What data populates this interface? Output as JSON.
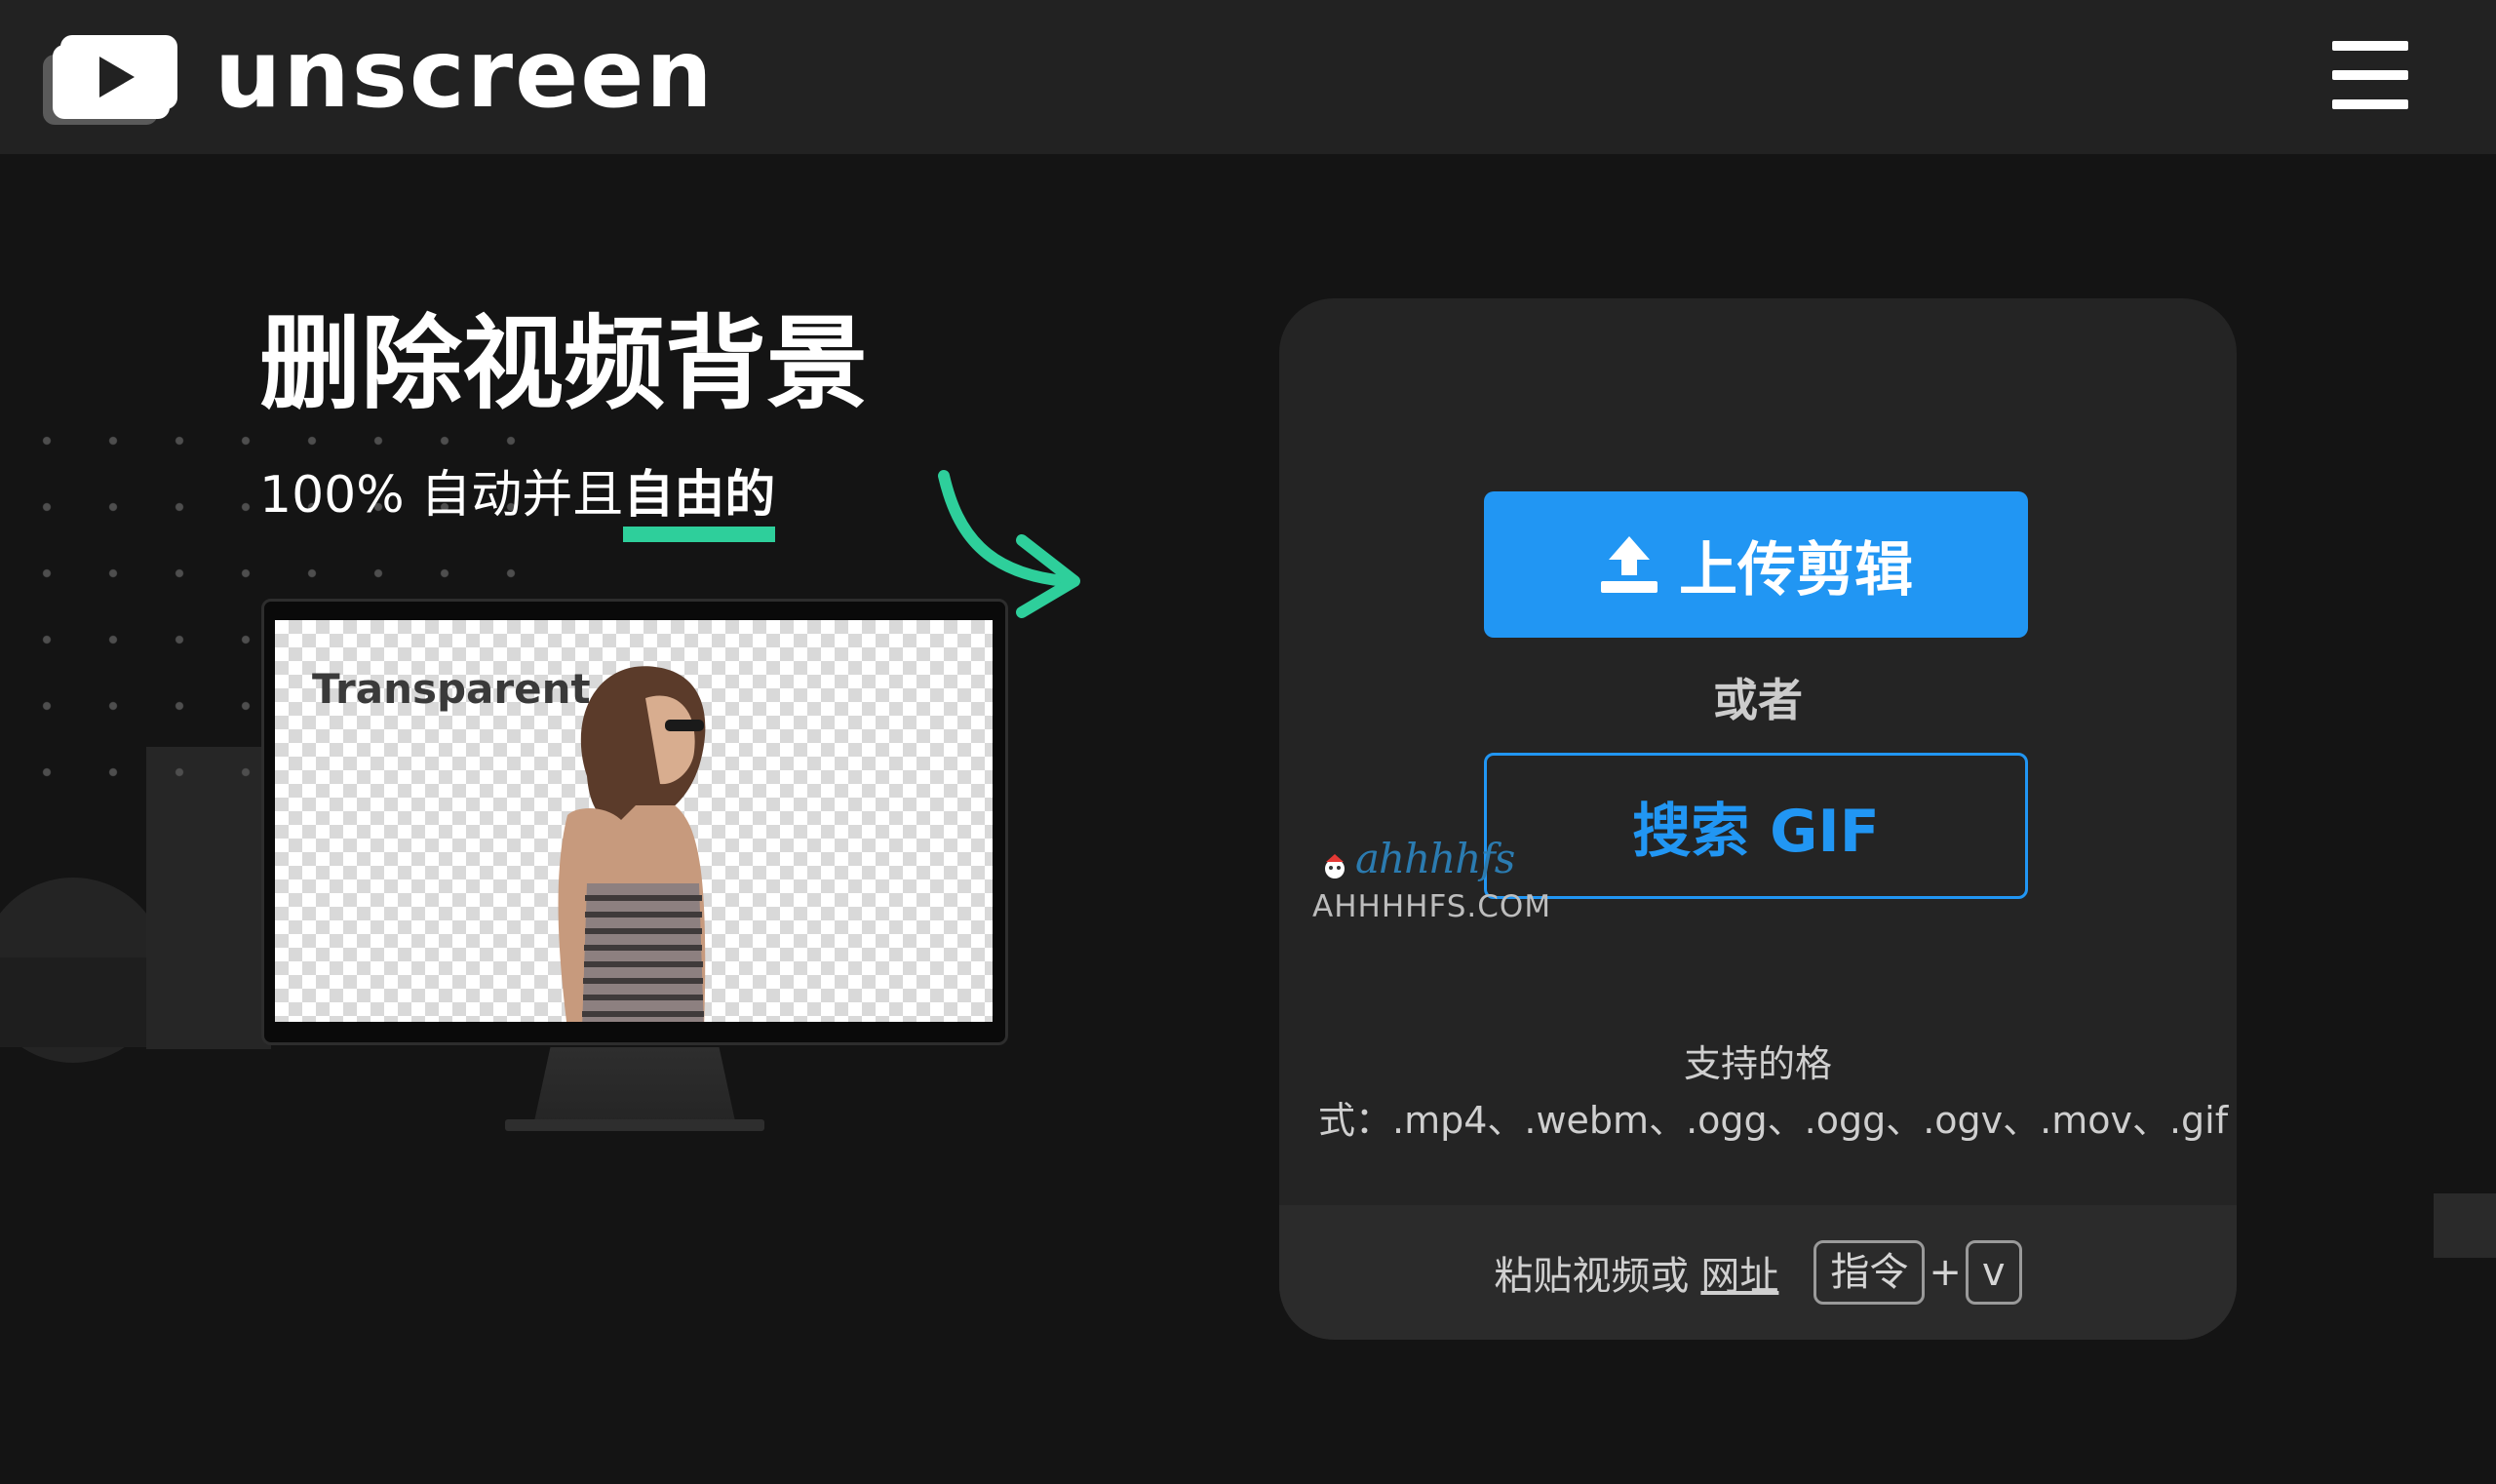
{
  "header": {
    "brand_name": "unscreen",
    "logo_icon": "play-logo-icon",
    "menu_icon": "hamburger-menu-icon"
  },
  "hero": {
    "title": "删除视频背景",
    "subtitle_prefix": "100% 自动并且",
    "subtitle_highlight": "自由的",
    "preview_label": "Transparent"
  },
  "upload_card": {
    "upload_button_label": "上传剪辑",
    "upload_icon": "upload-icon",
    "or_text": "或者",
    "search_gif_label": "搜索 GIF",
    "formats_line1": "支持的格",
    "formats_line2": "式：.mp4、.webm、.ogg、.ogg、.ogv、.mov、.gif",
    "paste_prefix": "粘贴视频或",
    "paste_link": "网址",
    "key_modifier": "指令",
    "key_plus": "+",
    "key_letter": "v"
  },
  "watermark": {
    "top": "ahhhhfs",
    "bottom": "AHHHHFS.COM"
  },
  "colors": {
    "background": "#141414",
    "header": "#222222",
    "card": "#242424",
    "primary": "#2196f3",
    "accent_green": "#2ecf9b"
  }
}
